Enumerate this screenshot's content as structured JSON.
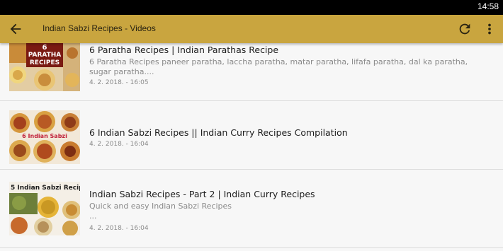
{
  "status_bar": {
    "time": "14:58"
  },
  "app_bar": {
    "title": "Indian Sabzi Recipes - Videos"
  },
  "videos": [
    {
      "title": "6 Paratha Recipes | Indian Parathas Recipe",
      "description": "6 Paratha Recipes paneer paratha, laccha paratha, matar paratha, lifafa paratha, dal ka paratha, sugar paratha....",
      "date": "4. 2. 2018. - 16:05",
      "thumb_text_1": "6",
      "thumb_text_2": "PARATHA",
      "thumb_text_3": "RECIPES"
    },
    {
      "title": "6 Indian Sabzi Recipes  || Indian Curry Recipes Compilation",
      "description": "",
      "date": "4. 2. 2018. - 16:04",
      "thumb_text_1": "6 Indian Sabzi"
    },
    {
      "title": "Indian Sabzi Recipes - Part 2 | Indian Curry Recipes",
      "description": "Quick and easy Indian Sabzi Recipes",
      "description_more": "...",
      "date": "4. 2. 2018. - 16:04",
      "thumb_text_1": "5 Indian Sabzi Recip"
    }
  ],
  "colors": {
    "app_bar": "#c9a53f",
    "background": "#f7f7f7",
    "status_bar": "#000000"
  },
  "icons": {
    "back": "arrow-left-icon",
    "refresh": "refresh-icon",
    "menu": "more-vertical-icon"
  }
}
